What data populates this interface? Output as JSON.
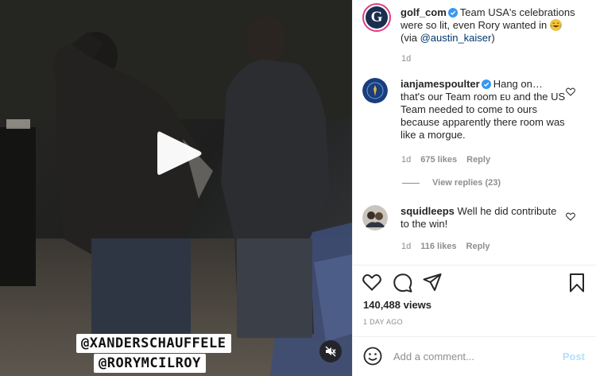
{
  "post": {
    "author": "golf_com",
    "avatar_letter": "G",
    "caption_text": "Team USA's celebrations were so lit, even Rory wanted in",
    "caption_via_prefix": "(via ",
    "caption_mention": "@austin_kaiser",
    "caption_via_suffix": ")",
    "caption_emoji": "laughing-emoji",
    "time": "1d"
  },
  "video": {
    "sticker_line1": "@XANDERSCHAUFFELE",
    "sticker_line2": "@RORYMCILROY"
  },
  "comments": [
    {
      "username": "ianjamespoulter",
      "verified": true,
      "text": "Hang on… that's our Team room ᴇᴜ and the US Team needed to come to ours because apparently there room was like a morgue.",
      "time": "1d",
      "likes": "675 likes",
      "reply_label": "Reply",
      "view_replies": "View replies (23)"
    },
    {
      "username": "squidleeps",
      "verified": false,
      "text": "Well he did contribute to the win!",
      "time": "1d",
      "likes": "116 likes",
      "reply_label": "Reply"
    }
  ],
  "stats": {
    "views": "140,488 views",
    "date": "1 DAY AGO"
  },
  "comment_box": {
    "placeholder": "Add a comment...",
    "post_label": "Post"
  },
  "colors": {
    "verified": "#3897f0",
    "link": "#00376b",
    "muted": "#8e8e8e",
    "post_disabled": "#b2dffc"
  }
}
